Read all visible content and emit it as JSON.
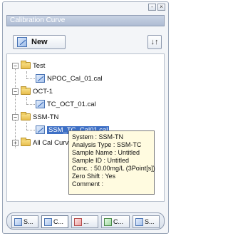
{
  "window": {
    "buttons": [
      "-",
      "×"
    ]
  },
  "panel": {
    "title": "Calibration Curve"
  },
  "toolbar": {
    "new_label": "New",
    "sort_label": "↓↑"
  },
  "tree": {
    "groups": [
      {
        "label": "Test",
        "expanded": true,
        "items": [
          "NPOC_Cal_01.cal"
        ]
      },
      {
        "label": "OCT-1",
        "expanded": true,
        "items": [
          "TC_OCT_01.cal"
        ]
      },
      {
        "label": "SSM-TN",
        "expanded": true,
        "items": [
          "SSM_TC_Cal01.cal"
        ]
      },
      {
        "label": "All Cal Curve Files",
        "expanded": false,
        "items": []
      }
    ],
    "selected_item": "SSM_TC_Cal01.cal"
  },
  "tooltip": {
    "lines": [
      "System : SSM-TN",
      "Analysis Type : SSM-TC",
      "Sample Name : Untitled",
      "Sample ID : Untitled",
      "Conc. : 50.00mg/L (3Point[s])",
      "Zero Shift : Yes",
      "Comment :"
    ]
  },
  "tabs": [
    {
      "label": "S...",
      "icon": "system-icon",
      "active": false
    },
    {
      "label": "C...",
      "icon": "calibration-icon",
      "active": true
    },
    {
      "label": "...",
      "icon": "sample-icon",
      "active": false
    },
    {
      "label": "C...",
      "icon": "control-icon",
      "active": false
    },
    {
      "label": "S...",
      "icon": "schedule-icon",
      "active": false
    }
  ],
  "colors": {
    "selection": "#3d6fc5",
    "tooltip_bg": "#fffbe0",
    "title_bar": "#aebcd3"
  }
}
